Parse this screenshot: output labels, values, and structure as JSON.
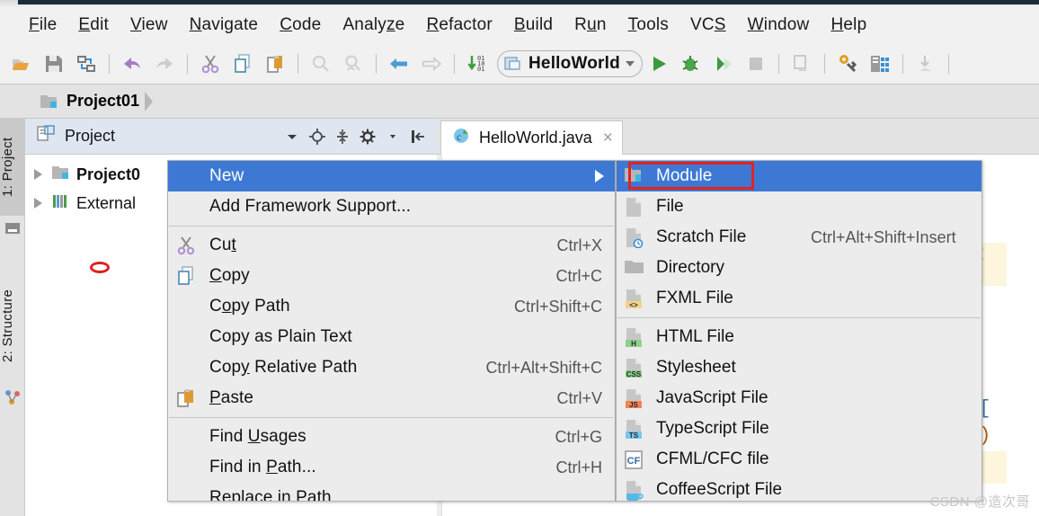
{
  "app": {
    "menubar": [
      {
        "name": "file",
        "pre": "",
        "u": "F",
        "post": "ile"
      },
      {
        "name": "edit",
        "pre": "",
        "u": "E",
        "post": "dit"
      },
      {
        "name": "view",
        "pre": "",
        "u": "V",
        "post": "iew"
      },
      {
        "name": "navigate",
        "pre": "",
        "u": "N",
        "post": "avigate"
      },
      {
        "name": "code",
        "pre": "",
        "u": "C",
        "post": "ode"
      },
      {
        "name": "analyze",
        "pre": "Analy",
        "u": "z",
        "post": "e"
      },
      {
        "name": "refactor",
        "pre": "",
        "u": "R",
        "post": "efactor"
      },
      {
        "name": "build",
        "pre": "",
        "u": "B",
        "post": "uild"
      },
      {
        "name": "run",
        "pre": "R",
        "u": "u",
        "post": "n"
      },
      {
        "name": "tools",
        "pre": "",
        "u": "T",
        "post": "ools"
      },
      {
        "name": "vcs",
        "pre": "VC",
        "u": "S",
        "post": ""
      },
      {
        "name": "window",
        "pre": "",
        "u": "W",
        "post": "indow"
      },
      {
        "name": "help",
        "pre": "",
        "u": "H",
        "post": "elp"
      }
    ],
    "toolbar": {
      "icons": [
        "open-folder-icon",
        "save-all-icon",
        "sync-refresh-icon",
        "undo-icon",
        "redo-icon",
        "cut-icon",
        "copy-icon",
        "paste-icon",
        "find-icon",
        "find-in-path-icon",
        "back-icon",
        "forward-icon",
        "compile-icon"
      ],
      "run_config": "HelloWorld",
      "run_icons": [
        "run-icon",
        "debug-icon",
        "run-coverage-icon",
        "stop-icon",
        "update-app-icon",
        "settings-wrench-icon",
        "project-structure-icon",
        "sdk-download-icon"
      ]
    },
    "breadcrumb": {
      "project": "Project01"
    }
  },
  "stripe": {
    "tabs": [
      {
        "name": "project",
        "label": "1: Project",
        "active": true
      },
      {
        "name": "structure",
        "label": "2: Structure",
        "active": false
      }
    ]
  },
  "project_window": {
    "title": "Project",
    "header_icons": [
      "chevron-down-icon",
      "locate-icon",
      "collapse-all-icon",
      "gear-icon",
      "hide-icon"
    ],
    "tree": [
      {
        "label": "Project0",
        "bold": true,
        "icon": "module-folder-icon"
      },
      {
        "label": "External",
        "bold": false,
        "icon": "external-libraries-icon"
      }
    ]
  },
  "editor": {
    "tab": {
      "label": "HelloWorld.java",
      "icon": "java-class-run-icon",
      "close": "×"
    }
  },
  "context_menu": {
    "items": [
      {
        "name": "new",
        "label": "New",
        "accel": "",
        "selected": true,
        "submenu": true,
        "icon": ""
      },
      {
        "name": "add-framework-support",
        "label": "Add Framework Support...",
        "accel": "",
        "icon": ""
      },
      {
        "separator": true
      },
      {
        "name": "cut",
        "pre": "Cu",
        "u": "t",
        "post": "",
        "label": "Cut",
        "accel": "Ctrl+X",
        "icon": "cut-icon"
      },
      {
        "name": "copy",
        "pre": "",
        "u": "C",
        "post": "opy",
        "label": "Copy",
        "accel": "Ctrl+C",
        "icon": "copy-icon"
      },
      {
        "name": "copy-path",
        "pre": "C",
        "u": "o",
        "post": "py Path",
        "label": "Copy Path",
        "accel": "Ctrl+Shift+C",
        "icon": ""
      },
      {
        "name": "copy-as-plain-text",
        "label": "Copy as Plain Text",
        "accel": "",
        "icon": ""
      },
      {
        "name": "copy-relative-path",
        "pre": "Cop",
        "u": "y",
        "post": " Relative Path",
        "label": "Copy Relative Path",
        "accel": "Ctrl+Alt+Shift+C",
        "icon": ""
      },
      {
        "name": "paste",
        "pre": "",
        "u": "P",
        "post": "aste",
        "label": "Paste",
        "accel": "Ctrl+V",
        "icon": "paste-icon"
      },
      {
        "separator": true
      },
      {
        "name": "find-usages",
        "pre": "Find ",
        "u": "U",
        "post": "sages",
        "label": "Find Usages",
        "accel": "Ctrl+G",
        "icon": ""
      },
      {
        "name": "find-in-path",
        "pre": "Find in ",
        "u": "P",
        "post": "ath...",
        "label": "Find in Path...",
        "accel": "Ctrl+H",
        "icon": ""
      },
      {
        "name": "replace-in-path",
        "label": "Replace in Path",
        "accel": "",
        "icon": "",
        "clipped": true
      }
    ]
  },
  "submenu": {
    "items": [
      {
        "name": "module",
        "label": "Module",
        "accel": "",
        "selected": true,
        "icon": "module-icon",
        "highlighted": true
      },
      {
        "name": "file",
        "label": "File",
        "accel": "",
        "icon": "file-icon"
      },
      {
        "name": "scratch-file",
        "label": "Scratch File",
        "accel": "Ctrl+Alt+Shift+Insert",
        "icon": "scratch-file-icon"
      },
      {
        "name": "directory",
        "label": "Directory",
        "accel": "",
        "icon": "directory-icon"
      },
      {
        "name": "fxml-file",
        "label": "FXML File",
        "accel": "",
        "icon": "fxml-file-icon"
      },
      {
        "separator": true
      },
      {
        "name": "html-file",
        "label": "HTML File",
        "accel": "",
        "icon": "html-file-icon"
      },
      {
        "name": "stylesheet",
        "label": "Stylesheet",
        "accel": "",
        "icon": "css-file-icon"
      },
      {
        "name": "javascript-file",
        "label": "JavaScript File",
        "accel": "",
        "icon": "js-file-icon"
      },
      {
        "name": "typescript-file",
        "label": "TypeScript File",
        "accel": "",
        "icon": "ts-file-icon"
      },
      {
        "name": "cfml-cfc-file",
        "label": "CFML/CFC file",
        "accel": "",
        "icon": "cf-file-icon"
      },
      {
        "name": "coffeescript-file",
        "label": "CoffeeScript File",
        "accel": "",
        "icon": "coffee-file-icon"
      }
    ]
  },
  "colors": {
    "selection_blue": "#3d79d4",
    "highlight_red": "#e02322",
    "menu_bg": "#ececec",
    "toolbar_bg": "#f1f1f1"
  },
  "watermark": {
    "text": "CSDN @造次哥"
  }
}
